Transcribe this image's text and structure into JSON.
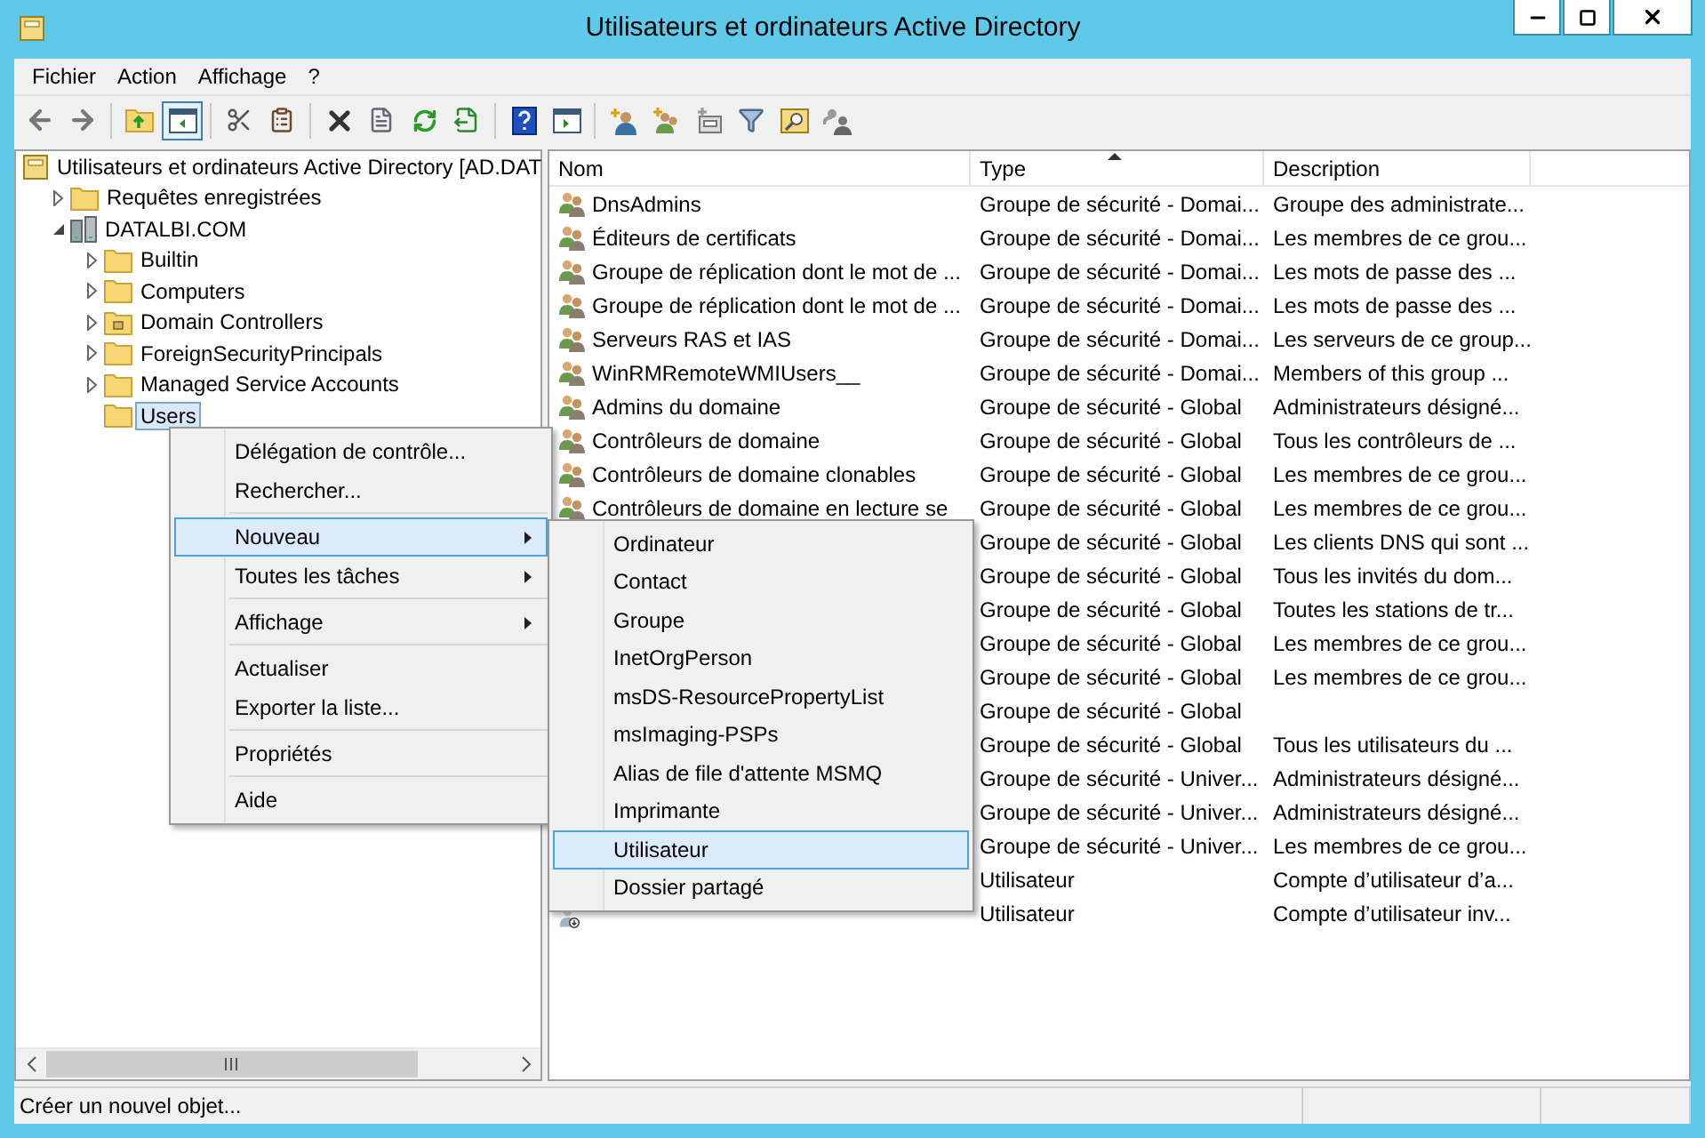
{
  "window": {
    "title": "Utilisateurs et ordinateurs Active Directory"
  },
  "menu_bar": [
    "Fichier",
    "Action",
    "Affichage",
    "?"
  ],
  "tree": {
    "label": "Utilisateurs et ordinateurs Active Directory [AD.DAT",
    "kind": "console",
    "selected": false,
    "children": [
      {
        "label": "Requêtes enregistrées",
        "kind": "folder",
        "expanded": false,
        "selected": false
      },
      {
        "label": "DATALBI.COM",
        "kind": "domain",
        "expanded": true,
        "selected": false,
        "children": [
          {
            "label": "Builtin",
            "kind": "folder",
            "expanded": false,
            "selected": false
          },
          {
            "label": "Computers",
            "kind": "folder",
            "expanded": false,
            "selected": false
          },
          {
            "label": "Domain Controllers",
            "kind": "ou",
            "expanded": false,
            "selected": false
          },
          {
            "label": "ForeignSecurityPrincipals",
            "kind": "folder",
            "expanded": false,
            "selected": false
          },
          {
            "label": "Managed Service Accounts",
            "kind": "folder",
            "expanded": false,
            "selected": false
          },
          {
            "label": "Users",
            "kind": "folder",
            "selected": true
          }
        ]
      }
    ]
  },
  "table": {
    "columns": [
      {
        "label": "Nom",
        "sorted": false
      },
      {
        "label": "Type",
        "sorted": true
      },
      {
        "label": "Description",
        "sorted": false
      }
    ],
    "rows": [
      {
        "kind": "group",
        "name": "DnsAdmins",
        "type": "Groupe de sécurité - Domai...",
        "description": "Groupe des administrate..."
      },
      {
        "kind": "group",
        "name": "Éditeurs de certificats",
        "type": "Groupe de sécurité - Domai...",
        "description": "Les membres de ce grou..."
      },
      {
        "kind": "group",
        "name": "Groupe de réplication dont le mot de ...",
        "type": "Groupe de sécurité - Domai...",
        "description": "Les mots de passe des ..."
      },
      {
        "kind": "group",
        "name": "Groupe de réplication dont le mot de ...",
        "type": "Groupe de sécurité - Domai...",
        "description": "Les mots de passe des ..."
      },
      {
        "kind": "group",
        "name": "Serveurs RAS et IAS",
        "type": "Groupe de sécurité - Domai...",
        "description": "Les serveurs de ce group..."
      },
      {
        "kind": "group",
        "name": "WinRMRemoteWMIUsers__",
        "type": "Groupe de sécurité - Domai...",
        "description": "Members of this group ..."
      },
      {
        "kind": "group",
        "name": "Admins du domaine",
        "type": "Groupe de sécurité - Global",
        "description": "Administrateurs désigné..."
      },
      {
        "kind": "group",
        "name": "Contrôleurs de domaine",
        "type": "Groupe de sécurité - Global",
        "description": "Tous les contrôleurs de ..."
      },
      {
        "kind": "group",
        "name": "Contrôleurs de domaine clonables",
        "type": "Groupe de sécurité - Global",
        "description": "Les membres de ce grou..."
      },
      {
        "kind": "group",
        "name": "Contrôleurs de domaine en lecture se",
        "type": "Groupe de sécurité - Global",
        "description": "Les membres de ce grou..."
      },
      {
        "type": "Groupe de sécurité - Global",
        "description": "Les clients DNS qui sont ..."
      },
      {
        "type": "Groupe de sécurité - Global",
        "description": "Tous les invités du dom..."
      },
      {
        "type": "Groupe de sécurité - Global",
        "description": "Toutes les stations de tr..."
      },
      {
        "type": "Groupe de sécurité - Global",
        "description": "Les membres de ce grou..."
      },
      {
        "type": "Groupe de sécurité - Global",
        "description": "Les membres de ce grou..."
      },
      {
        "type": "Groupe de sécurité - Global"
      },
      {
        "type": "Groupe de sécurité - Global",
        "description": "Tous les utilisateurs du ..."
      },
      {
        "type": "Groupe de sécurité - Univer...",
        "description": "Administrateurs désigné..."
      },
      {
        "type": "Groupe de sécurité - Univer...",
        "description": "Administrateurs désigné..."
      },
      {
        "type": "Groupe de sécurité - Univer...",
        "description": "Les membres de ce grou..."
      },
      {
        "type": "Utilisateur",
        "description": "Compte d’utilisateur d’a..."
      },
      {
        "kind": "user_disabled",
        "type": "Utilisateur",
        "description": "Compte d’utilisateur inv..."
      }
    ]
  },
  "context_menu": [
    {
      "kind": "item",
      "label": "Délégation de contrôle...",
      "submenu": false,
      "selected": false
    },
    {
      "kind": "item",
      "label": "Rechercher...",
      "submenu": false,
      "selected": false
    },
    {
      "kind": "separator"
    },
    {
      "kind": "item",
      "label": "Nouveau",
      "submenu": true,
      "selected": true
    },
    {
      "kind": "item",
      "label": "Toutes les tâches",
      "submenu": true,
      "selected": false
    },
    {
      "kind": "separator"
    },
    {
      "kind": "item",
      "label": "Affichage",
      "submenu": true,
      "selected": false
    },
    {
      "kind": "separator"
    },
    {
      "kind": "item",
      "label": "Actualiser",
      "submenu": false,
      "selected": false
    },
    {
      "kind": "item",
      "label": "Exporter la liste...",
      "submenu": false,
      "selected": false
    },
    {
      "kind": "separator"
    },
    {
      "kind": "item",
      "label": "Propriétés",
      "submenu": false,
      "selected": false
    },
    {
      "kind": "separator"
    },
    {
      "kind": "item",
      "label": "Aide",
      "submenu": false,
      "selected": false
    }
  ],
  "submenu": [
    {
      "label": "Ordinateur",
      "selected": false
    },
    {
      "label": "Contact",
      "selected": false
    },
    {
      "label": "Groupe",
      "selected": false
    },
    {
      "label": "InetOrgPerson",
      "selected": false
    },
    {
      "label": "msDS-ResourcePropertyList",
      "selected": false
    },
    {
      "label": "msImaging-PSPs",
      "selected": false
    },
    {
      "label": "Alias de file d'attente MSMQ",
      "selected": false
    },
    {
      "label": "Imprimante",
      "selected": false
    },
    {
      "label": "Utilisateur",
      "selected": true
    },
    {
      "label": "Dossier partagé",
      "selected": false
    }
  ],
  "status_bar": {
    "text": "Créer un nouvel objet..."
  }
}
